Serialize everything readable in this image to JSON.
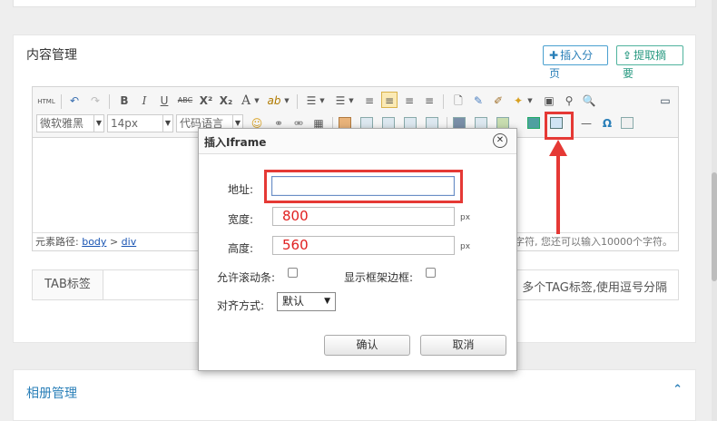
{
  "content_panel": {
    "title": "内容管理",
    "insert_page_button": "插入分页",
    "extract_summary_button": "提取摘要"
  },
  "toolbar": {
    "html_label": "HTML",
    "bold": "B",
    "italic": "I",
    "underline": "U",
    "strike": "ABC",
    "superscript": "X²",
    "subscript": "X₂",
    "font_color": "A",
    "font_family": "微软雅黑",
    "font_size": "14px",
    "code_language": "代码语言"
  },
  "pathbar": {
    "prefix": "元素路径:",
    "path_body": "body",
    "path_sep": ">",
    "path_div": "div",
    "counter_text": "字符, 您还可以输入10000个字符。"
  },
  "tag_row": {
    "label": "TAB标签",
    "hint": "多个TAG标签,使用逗号分隔"
  },
  "album_panel": {
    "title": "相册管理"
  },
  "dialog": {
    "title": "插入Iframe",
    "address_label": "地址:",
    "address_value": "",
    "width_label": "宽度:",
    "width_value": "800",
    "height_label": "高度:",
    "height_value": "560",
    "unit": "px",
    "scroll_label": "允许滚动条:",
    "border_label": "显示框架边框:",
    "align_label": "对齐方式:",
    "align_value": "默认",
    "ok_button": "确认",
    "cancel_button": "取消"
  },
  "colors": {
    "highlight": "#e53935",
    "accent_blue": "#2a7fb8",
    "accent_green": "#2a9a82"
  }
}
